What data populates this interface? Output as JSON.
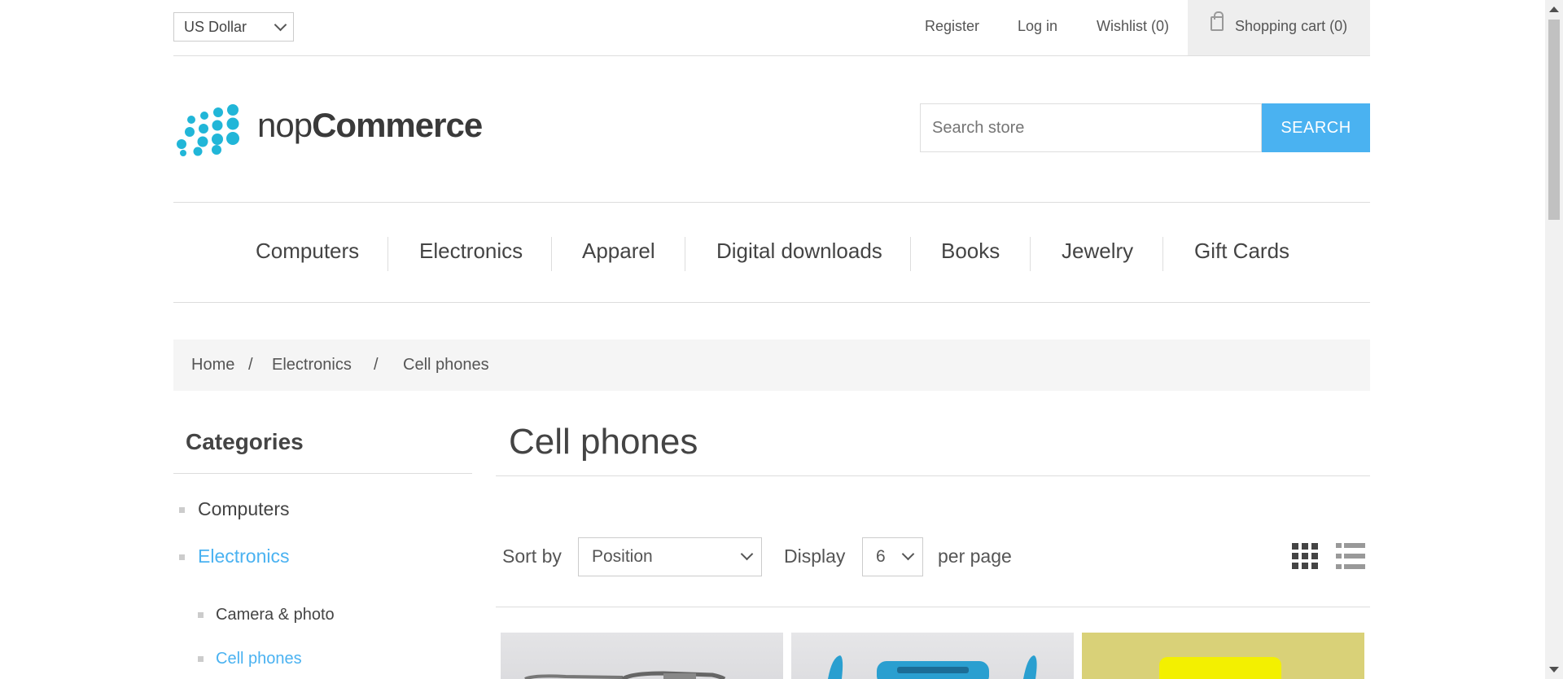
{
  "header": {
    "currency": "US Dollar",
    "links": [
      "Register",
      "Log in",
      "Wishlist (0)"
    ],
    "cart": "Shopping cart (0)"
  },
  "logo": {
    "prefix": "nop",
    "suffix": "Commerce"
  },
  "search": {
    "placeholder": "Search store",
    "button": "SEARCH"
  },
  "menu": [
    "Computers",
    "Electronics",
    "Apparel",
    "Digital downloads",
    "Books",
    "Jewelry",
    "Gift Cards"
  ],
  "breadcrumb": {
    "home": "Home",
    "sep": "/",
    "parent": "Electronics",
    "current": "Cell phones"
  },
  "sidebar": {
    "title": "Categories",
    "items": [
      "Computers",
      "Electronics"
    ],
    "subitems": [
      "Camera & photo",
      "Cell phones"
    ]
  },
  "main": {
    "title": "Cell phones",
    "sort_label": "Sort by",
    "sort_value": "Position",
    "display_label": "Display",
    "display_value": "6",
    "per_page": "per page"
  },
  "colors": {
    "accent": "#4ab2f1",
    "logo_dots": "#21b6d8",
    "product3_bg": "#d9d178"
  }
}
